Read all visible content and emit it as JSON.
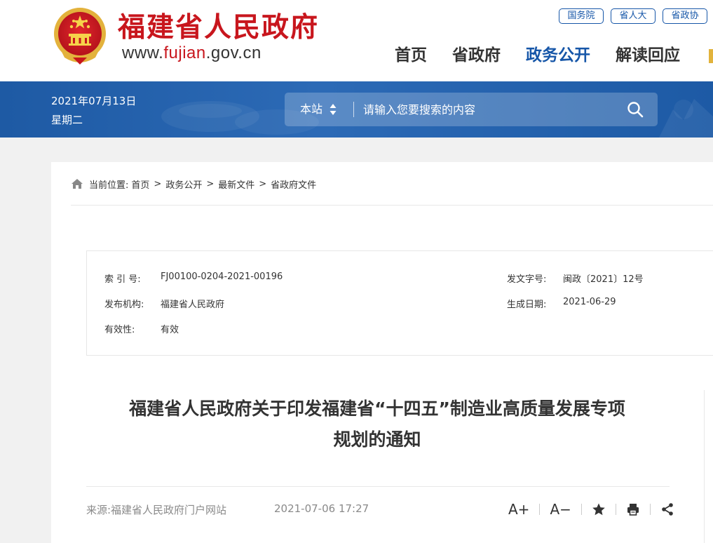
{
  "header": {
    "site_name": "福建省人民政府",
    "url_prefix": "www.",
    "url_highlight": "fujian",
    "url_suffix": ".gov.cn",
    "top_links": [
      "国务院",
      "省人大",
      "省政协"
    ],
    "nav": [
      "首页",
      "省政府",
      "政务公开",
      "解读回应"
    ],
    "active_nav": "政务公开"
  },
  "banner": {
    "date": "2021年07月13日",
    "weekday": "星期二",
    "search_scope": "本站",
    "search_placeholder": "请输入您要搜索的内容"
  },
  "breadcrumb": {
    "prefix": "当前位置:",
    "items": [
      "首页",
      "政务公开",
      "最新文件",
      "省政府文件"
    ],
    "separator": ">"
  },
  "meta": {
    "index_label": "索 引 号:",
    "index_value": "FJ00100-0204-2021-00196",
    "doc_no_label": "发文字号:",
    "doc_no_value": "闽政〔2021〕12号",
    "org_label": "发布机构:",
    "org_value": "福建省人民政府",
    "date_label": "生成日期:",
    "date_value": "2021-06-29",
    "validity_label": "有效性:",
    "validity_value": "有效"
  },
  "article": {
    "title_line1": "福建省人民政府关于印发福建省“十四五”制造业高质量发展专项",
    "title_line2": "规划的通知",
    "source": "来源:福建省人民政府门户网站",
    "published": "2021-07-06 17:27",
    "tools": {
      "font_larger": "A+",
      "font_smaller": "A−"
    }
  },
  "colors": {
    "brand_red": "#c8161d",
    "brand_blue": "#1656a8",
    "banner_blue": "#1e5aa4"
  }
}
